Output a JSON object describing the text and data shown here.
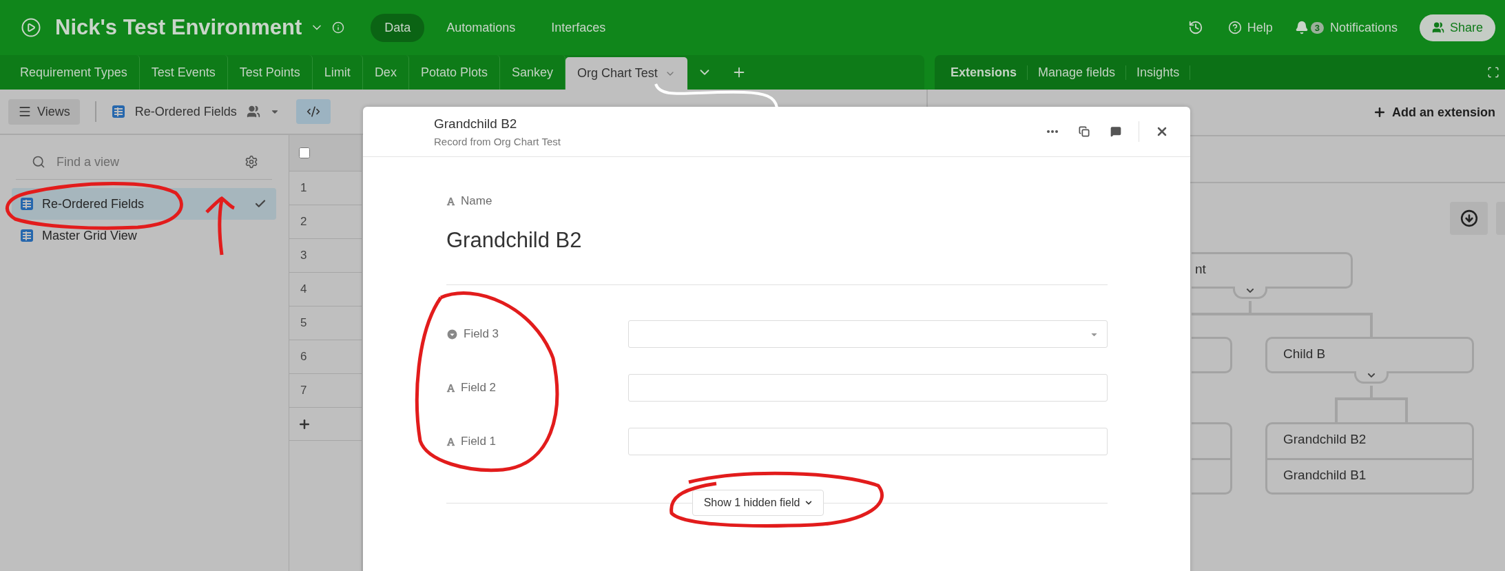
{
  "base": {
    "title": "Nick's Test Environment"
  },
  "nav": [
    {
      "label": "Data",
      "selected": true
    },
    {
      "label": "Automations",
      "selected": false
    },
    {
      "label": "Interfaces",
      "selected": false
    }
  ],
  "header_actions": {
    "help": "Help",
    "notification_count": "3",
    "notifications": "Notifications",
    "share": "Share"
  },
  "tables": [
    {
      "label": "Requirement Types",
      "selected": false
    },
    {
      "label": "Test Events",
      "selected": false
    },
    {
      "label": "Test Points",
      "selected": false
    },
    {
      "label": "Limit",
      "selected": false
    },
    {
      "label": "Dex",
      "selected": false
    },
    {
      "label": "Potato Plots",
      "selected": false
    },
    {
      "label": "Sankey",
      "selected": false
    },
    {
      "label": "Org Chart Test",
      "selected": true
    }
  ],
  "panel_tabs": [
    {
      "label": "Extensions",
      "selected": true
    },
    {
      "label": "Manage fields",
      "selected": false
    },
    {
      "label": "Insights",
      "selected": false
    }
  ],
  "toolbar": {
    "views": "Views",
    "current_view": "Re-Ordered Fields"
  },
  "sidebar": {
    "search_placeholder": "Find a view",
    "views": [
      {
        "name": "Re-Ordered Fields",
        "selected": true
      },
      {
        "name": "Master Grid View",
        "selected": false
      }
    ]
  },
  "grid": {
    "select_all_checked": false,
    "row_numbers": [
      "1",
      "2",
      "3",
      "4",
      "5",
      "6",
      "7"
    ]
  },
  "record": {
    "title": "Grandchild B2",
    "subtitle": "Record from Org Chart Test",
    "name_label": "Name",
    "name_value": "Grandchild B2",
    "fields": [
      {
        "label": "Field 3",
        "kind": "select"
      },
      {
        "label": "Field 2",
        "kind": "text"
      },
      {
        "label": "Field 1",
        "kind": "text"
      }
    ],
    "show_hidden": "Show 1 hidden field"
  },
  "extensions": {
    "add": "Add an extension",
    "org_chart": {
      "root": "nt",
      "root_expanded": true,
      "child": "Child B",
      "child_expanded": true,
      "grandchildren": [
        "Grandchild B2",
        "Grandchild B1"
      ]
    }
  }
}
